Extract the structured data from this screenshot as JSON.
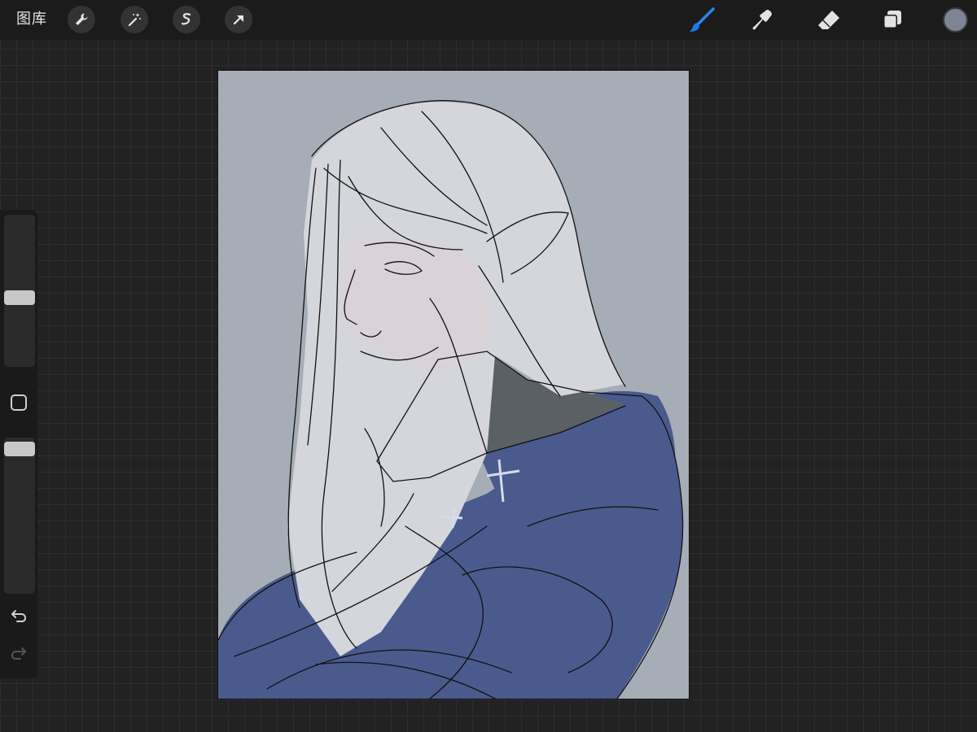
{
  "topbar": {
    "gallery_label": "图库",
    "left_tools": [
      {
        "icon": "wrench-icon",
        "name": "actions"
      },
      {
        "icon": "magic-wand-icon",
        "name": "adjustments"
      },
      {
        "icon": "selection-icon",
        "name": "selection"
      },
      {
        "icon": "arrow-icon",
        "name": "transform"
      }
    ],
    "right_tools": [
      {
        "icon": "brush-icon",
        "name": "paint",
        "active": true
      },
      {
        "icon": "smudge-icon",
        "name": "smudge"
      },
      {
        "icon": "eraser-icon",
        "name": "erase"
      },
      {
        "icon": "layers-icon",
        "name": "layers"
      }
    ],
    "current_color": "#7d8594"
  },
  "colors": {
    "accent": "#1e78e8",
    "canvas_background": "#a7adb6",
    "coat": "#4a5a8d",
    "hair": "#d4d6db",
    "skin": "#d9d2d6",
    "collar": "#5b6064"
  },
  "sidebar": {
    "brush_size_level": 0.38,
    "opacity_level": 0.05,
    "modify_icon": "square-icon",
    "undo_icon": "undo-icon",
    "redo_icon": "redo-icon",
    "redo_enabled": false
  }
}
